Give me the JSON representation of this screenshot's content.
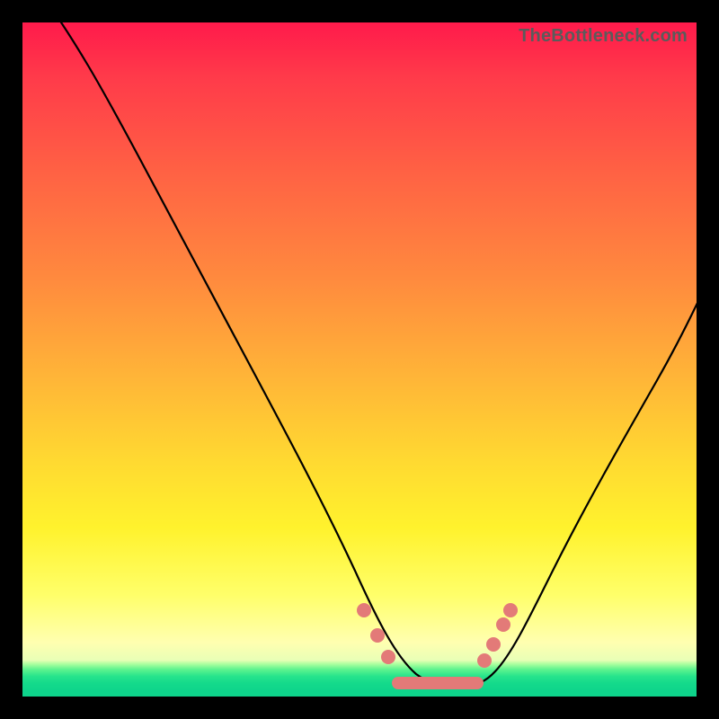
{
  "watermark": "TheBottleneck.com",
  "colors": {
    "frame": "#000000",
    "curve": "#000000",
    "marker": "#e37a78",
    "gradient_top": "#ff1a4b",
    "gradient_mid": "#ffd931",
    "gradient_bottom": "#0dd38b"
  },
  "chart_data": {
    "type": "line",
    "title": "",
    "xlabel": "",
    "ylabel": "",
    "xlim": [
      0,
      100
    ],
    "ylim": [
      0,
      100
    ],
    "grid": false,
    "legend": "none",
    "annotations": [
      "TheBottleneck.com"
    ],
    "series": [
      {
        "name": "bottleneck-curve",
        "x": [
          0,
          6,
          12,
          18,
          24,
          30,
          36,
          42,
          48,
          52,
          56,
          60,
          64,
          68,
          72,
          76,
          80,
          86,
          92,
          98,
          100
        ],
        "values": [
          108,
          100,
          90,
          80,
          70,
          60,
          50,
          40,
          28,
          18,
          9,
          4,
          2,
          2,
          4,
          10,
          20,
          34,
          48,
          60,
          64
        ]
      }
    ],
    "markers": [
      {
        "x": 50.5,
        "y": 13
      },
      {
        "x": 52.5,
        "y": 9
      },
      {
        "x": 54.0,
        "y": 6
      },
      {
        "x": 68.5,
        "y": 5.5
      },
      {
        "x": 70.0,
        "y": 8
      },
      {
        "x": 71.5,
        "y": 11
      },
      {
        "x": 72.5,
        "y": 13
      }
    ],
    "plateau": {
      "x_start": 55,
      "x_end": 67,
      "y": 2
    }
  }
}
